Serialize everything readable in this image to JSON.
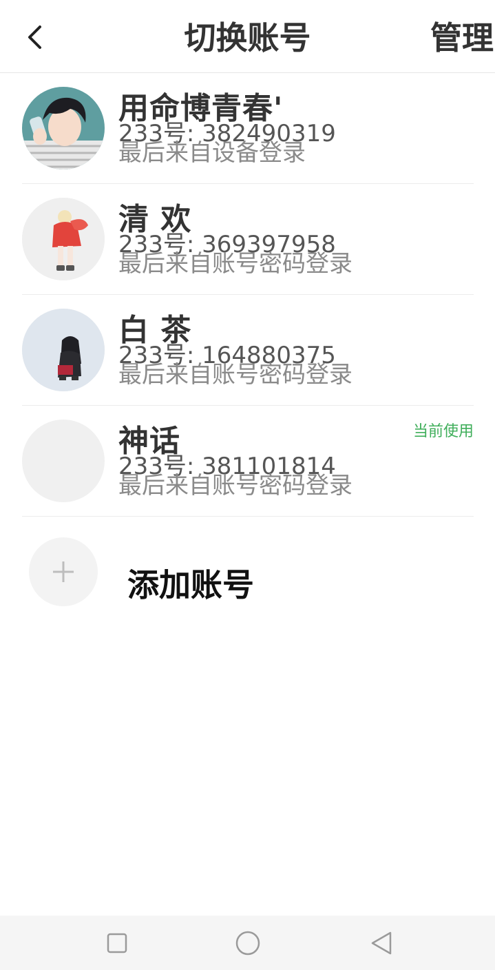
{
  "header": {
    "title": "切换账号",
    "manage_label": "管理",
    "back_icon": "chevron-left-icon"
  },
  "accounts": [
    {
      "nickname": "用命博青春'",
      "uid_text": "233号: 382490319",
      "last_login": "最后来自设备登录",
      "avatar": "boy-portrait-avatar"
    },
    {
      "nickname": "清 欢",
      "uid_text": "233号: 369397958",
      "last_login": "最后来自账号密码登录",
      "avatar": "girl-red-outfit-avatar"
    },
    {
      "nickname": "白 茶",
      "uid_text": "233号: 164880375",
      "last_login": "最后来自账号密码登录",
      "avatar": "dark-hair-figure-avatar"
    },
    {
      "nickname": "神话",
      "uid_text": "233号: 381101814",
      "last_login": "最后来自账号密码登录",
      "avatar": "blank-avatar",
      "badge": "当前使用"
    }
  ],
  "add_account": {
    "label": "添加账号",
    "icon": "plus-icon"
  },
  "navbar": {
    "recent_icon": "square-icon",
    "home_icon": "circle-icon",
    "back_icon": "triangle-back-icon"
  },
  "colors": {
    "badge_green": "#3fae5a",
    "text_dark": "#333333",
    "text_gray": "#8a8a8a",
    "divider": "#ececec",
    "navbar_bg": "#f5f5f5"
  }
}
